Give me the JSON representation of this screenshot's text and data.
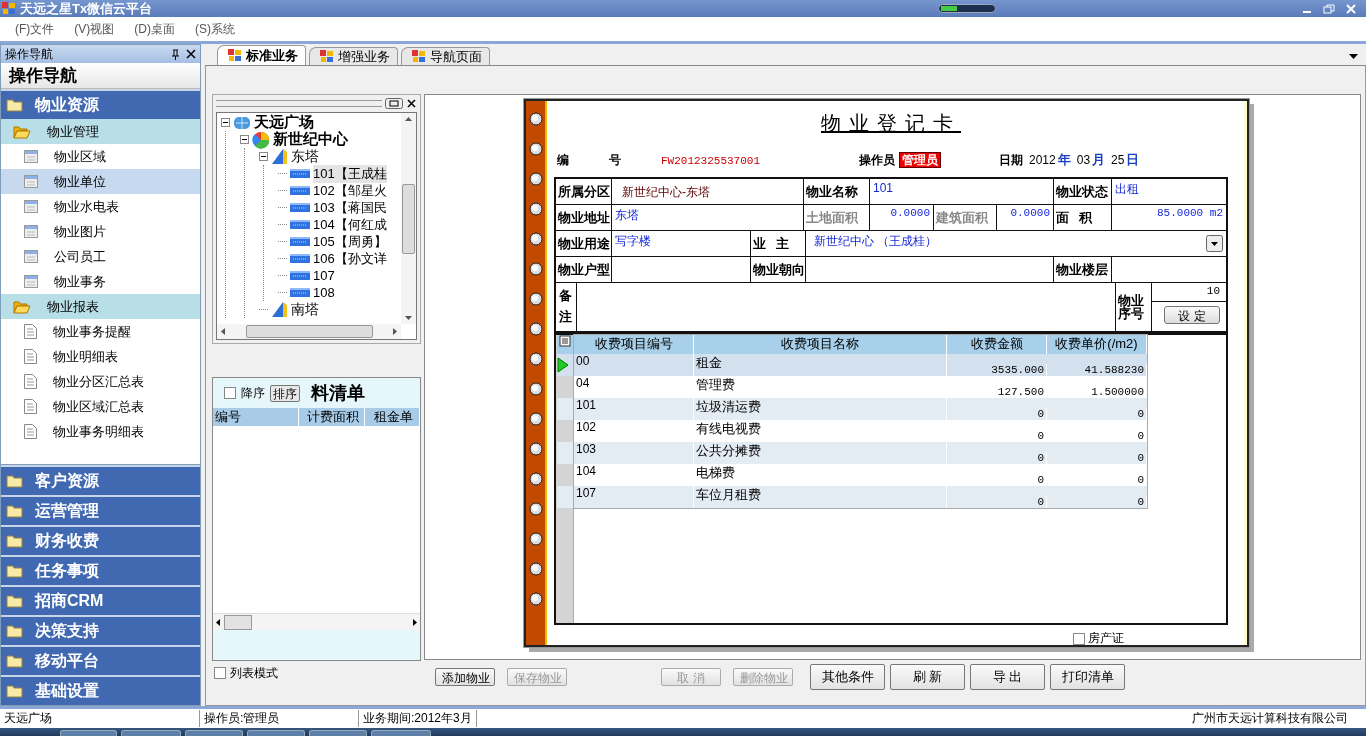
{
  "window": {
    "title": "天远之星Tx微信云平台"
  },
  "menu": [
    "(F)文件",
    "(V)视图",
    "(D)桌面",
    "(S)系统"
  ],
  "nav": {
    "pane_title": "操作导航",
    "heading": "操作导航",
    "groups": [
      {
        "label": "物业资源",
        "sections": [
          {
            "label": "物业管理",
            "items": [
              {
                "label": "物业区域",
                "kind": "form",
                "selected": false
              },
              {
                "label": "物业单位",
                "kind": "form",
                "selected": true
              },
              {
                "label": "物业水电表",
                "kind": "form",
                "selected": false
              },
              {
                "label": "物业图片",
                "kind": "form",
                "selected": false
              },
              {
                "label": "公司员工",
                "kind": "form",
                "selected": false
              },
              {
                "label": "物业事务",
                "kind": "form",
                "selected": false
              }
            ]
          },
          {
            "label": "物业报表",
            "items": [
              {
                "label": "物业事务提醒",
                "kind": "report",
                "selected": false
              },
              {
                "label": "物业明细表",
                "kind": "report",
                "selected": false
              },
              {
                "label": "物业分区汇总表",
                "kind": "report",
                "selected": false
              },
              {
                "label": "物业区域汇总表",
                "kind": "report",
                "selected": false
              },
              {
                "label": "物业事务明细表",
                "kind": "report",
                "selected": false
              }
            ]
          }
        ]
      },
      {
        "label": "客户资源"
      },
      {
        "label": "运营管理"
      },
      {
        "label": "财务收费"
      },
      {
        "label": "任务事项"
      },
      {
        "label": "招商CRM"
      },
      {
        "label": "决策支持"
      },
      {
        "label": "移动平台"
      },
      {
        "label": "基础设置"
      }
    ]
  },
  "tabs": [
    {
      "label": "标准业务",
      "selected": true
    },
    {
      "label": "增强业务",
      "selected": false
    },
    {
      "label": "导航页面",
      "selected": false
    }
  ],
  "tree": {
    "nodes": [
      {
        "label": "天远广场",
        "kind": "site",
        "expanded": true,
        "children": [
          {
            "label": "新世纪中心",
            "kind": "building",
            "expanded": true,
            "children": [
              {
                "label": "东塔",
                "kind": "tower",
                "expanded": true,
                "children": [
                  {
                    "label": "101【王成桂",
                    "kind": "unit",
                    "selected": true
                  },
                  {
                    "label": "102【邹星火",
                    "kind": "unit",
                    "selected": false
                  },
                  {
                    "label": "103【蒋国民",
                    "kind": "unit",
                    "selected": false
                  },
                  {
                    "label": "104【何红成",
                    "kind": "unit",
                    "selected": false
                  },
                  {
                    "label": "105【周勇】",
                    "kind": "unit",
                    "selected": false
                  },
                  {
                    "label": "106【孙文详",
                    "kind": "unit",
                    "selected": false
                  },
                  {
                    "label": "107",
                    "kind": "unit",
                    "selected": false
                  },
                  {
                    "label": "108",
                    "kind": "unit",
                    "selected": false
                  }
                ]
              },
              {
                "label": "南塔",
                "kind": "tower"
              }
            ]
          }
        ]
      }
    ]
  },
  "list": {
    "sort_desc": {
      "label": "降序",
      "checked": false
    },
    "sort_button": "排序",
    "title": "料清单",
    "columns": [
      "编号",
      "计费面积",
      "租金单"
    ]
  },
  "list_mode": {
    "label": "列表模式",
    "checked": false
  },
  "card": {
    "title": "物业登记卡",
    "number_label": "编号",
    "number": "FW2012325537001",
    "operator_label": "操作员",
    "operator": "管理员",
    "date_label": "日期",
    "date": [
      {
        "text": "2012",
        "kind": "value"
      },
      {
        "text": "年",
        "kind": "unit"
      },
      {
        "text": "03",
        "kind": "value"
      },
      {
        "text": "月",
        "kind": "unit"
      },
      {
        "text": "25",
        "kind": "value"
      },
      {
        "text": "日",
        "kind": "unit"
      }
    ],
    "fields": [
      [
        {
          "kind": "label",
          "text": "所属分区",
          "disabled": false
        },
        {
          "kind": "readonly",
          "text": "新世纪中心-东塔"
        },
        {
          "kind": "label",
          "text": "物业名称",
          "disabled": false
        },
        {
          "kind": "value",
          "text": "101"
        },
        {
          "kind": "label",
          "text": "物业状态",
          "disabled": false
        },
        {
          "kind": "value",
          "text": "出租"
        }
      ],
      [
        {
          "kind": "label",
          "text": "物业地址",
          "disabled": false
        },
        {
          "kind": "value",
          "text": "东塔"
        },
        {
          "kind": "label",
          "text": "土地面积",
          "disabled": true
        },
        {
          "kind": "number",
          "text": "0.0000"
        },
        {
          "kind": "label",
          "text": "建筑面积",
          "disabled": true
        },
        {
          "kind": "number",
          "text": "0.0000"
        },
        {
          "kind": "label",
          "text": "面积",
          "disabled": false
        },
        {
          "kind": "number",
          "text": "85.0000 m2"
        }
      ],
      [
        {
          "kind": "label",
          "text": "物业用途",
          "disabled": false
        },
        {
          "kind": "value",
          "text": "写字楼"
        },
        {
          "kind": "label",
          "text": "业主",
          "disabled": false
        },
        {
          "kind": "combo",
          "text": "新世纪中心 （王成桂）"
        }
      ],
      [
        {
          "kind": "label",
          "text": "物业户型",
          "disabled": false
        },
        {
          "kind": "value"
        },
        {
          "kind": "label",
          "text": "物业朝向",
          "disabled": false
        },
        {
          "kind": "value"
        },
        {
          "kind": "label",
          "text": "物业楼层",
          "disabled": false
        },
        {
          "kind": "value"
        }
      ],
      [
        {
          "kind": "vlabel",
          "text": "备注"
        },
        {
          "kind": "value"
        },
        {
          "kind": "label",
          "text": "物业序号",
          "disabled": false
        },
        {
          "kind": "serial",
          "text": "10",
          "button": "设 定"
        }
      ]
    ],
    "fees": {
      "columns": [
        "收费项目编号",
        "收费项目名称",
        "收费金额",
        "收费单价(/m2)"
      ],
      "rows": [
        {
          "code": "00",
          "name": "租金",
          "amount": "3535.000",
          "price": "41.588230",
          "selected": true
        },
        {
          "code": "04",
          "name": "管理费",
          "amount": "127.500",
          "price": "1.500000",
          "selected": false
        },
        {
          "code": "101",
          "name": "垃圾清运费",
          "amount": "0",
          "price": "0",
          "selected": false
        },
        {
          "code": "102",
          "name": "有线电视费",
          "amount": "0",
          "price": "0",
          "selected": false
        },
        {
          "code": "103",
          "name": "公共分摊费",
          "amount": "0",
          "price": "0",
          "selected": false
        },
        {
          "code": "104",
          "name": "电梯费",
          "amount": "0",
          "price": "0",
          "selected": false
        },
        {
          "code": "107",
          "name": "车位月租费",
          "amount": "0",
          "price": "0",
          "selected": false
        }
      ]
    },
    "deed": {
      "label": "房产证",
      "checked": false
    }
  },
  "record_buttons": [
    {
      "label": "添加物业",
      "disabled": false
    },
    {
      "label": "保存物业",
      "disabled": true
    },
    {
      "label": "取 消",
      "disabled": true
    },
    {
      "label": "删除物业",
      "disabled": true
    }
  ],
  "list_buttons": [
    {
      "label": "其他条件",
      "disabled": false
    },
    {
      "label": "刷 新",
      "disabled": false
    },
    {
      "label": "导 出",
      "disabled": false
    },
    {
      "label": "打印清单",
      "disabled": false
    }
  ],
  "status_bar": [
    "天远广场",
    "操作员:管理员",
    "业务期间:2012年3月",
    "广州市天远计算科技有限公司"
  ]
}
